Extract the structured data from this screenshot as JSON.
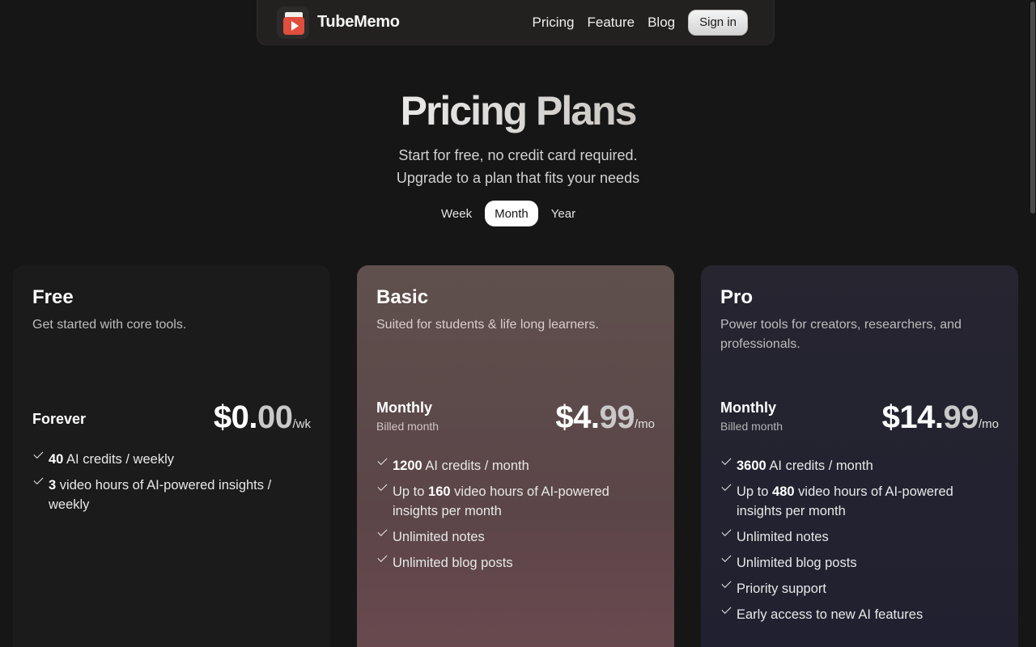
{
  "brand": {
    "name": "TubeMemo"
  },
  "nav": {
    "links": [
      "Pricing",
      "Feature",
      "Blog"
    ],
    "signin": "Sign in"
  },
  "hero": {
    "title": "Pricing Plans",
    "subtitle_1": "Start for free, no credit card required.",
    "subtitle_2": "Upgrade to a plan that fits your needs"
  },
  "period_toggle": {
    "options": [
      "Week",
      "Month",
      "Year"
    ],
    "selected": "Month"
  },
  "plans": [
    {
      "name": "Free",
      "desc": "Get started with core tools.",
      "period": "Forever",
      "billed": "",
      "price_main": "$0.",
      "price_cents": "00",
      "price_unit": "/wk",
      "features": [
        {
          "bold": "40",
          "text": " AI credits / weekly"
        },
        {
          "bold": "3",
          "text": " video hours of AI-powered insights / weekly"
        }
      ]
    },
    {
      "name": "Basic",
      "desc": "Suited for students & life long learners.",
      "period": "Monthly",
      "billed": "Billed month",
      "price_main": "$4.",
      "price_cents": "99",
      "price_unit": "/mo",
      "features": [
        {
          "pre": "",
          "bold": "1200",
          "text": " AI credits / month"
        },
        {
          "pre": "Up to ",
          "bold": "160",
          "text": " video hours of AI-powered insights per month"
        },
        {
          "pre": "",
          "bold": "",
          "text": "Unlimited notes"
        },
        {
          "pre": "",
          "bold": "",
          "text": "Unlimited blog posts"
        }
      ]
    },
    {
      "name": "Pro",
      "desc": "Power tools for creators, researchers, and professionals.",
      "period": "Monthly",
      "billed": "Billed month",
      "price_main": "$14.",
      "price_cents": "99",
      "price_unit": "/mo",
      "features": [
        {
          "pre": "",
          "bold": "3600",
          "text": " AI credits / month"
        },
        {
          "pre": "Up to ",
          "bold": "480",
          "text": " video hours of AI-powered insights per month"
        },
        {
          "pre": "",
          "bold": "",
          "text": "Unlimited notes"
        },
        {
          "pre": "",
          "bold": "",
          "text": "Unlimited blog posts"
        },
        {
          "pre": "",
          "bold": "",
          "text": "Priority support"
        },
        {
          "pre": "",
          "bold": "",
          "text": "Early access to new AI features"
        }
      ]
    }
  ],
  "colors": {
    "background": "#161616",
    "basic_card": "#5f504d",
    "pro_card": "#262530",
    "logo_red": "#e04f3d"
  },
  "icons": {
    "logo": "video-note-logo",
    "feature": "check-icon"
  }
}
